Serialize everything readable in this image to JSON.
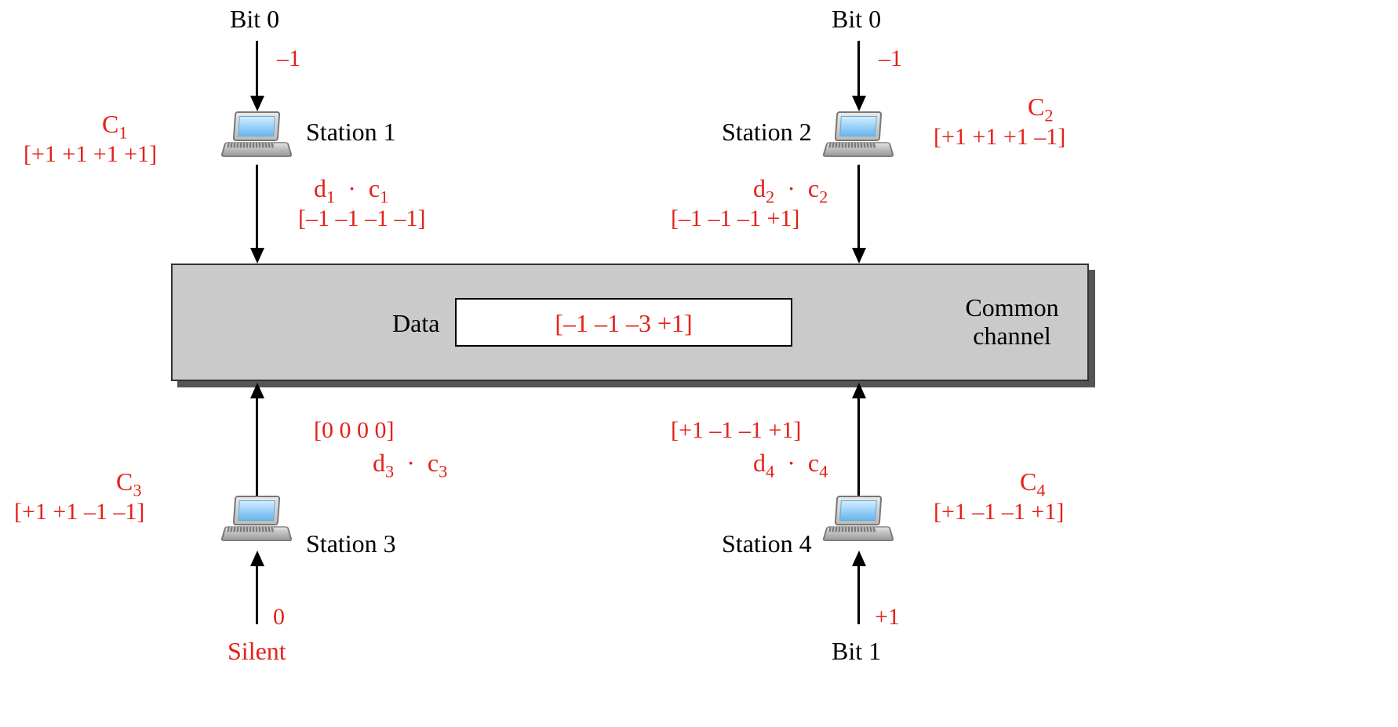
{
  "station1": {
    "bit_label": "Bit 0",
    "bit_value": "–1",
    "name": "Station 1",
    "code_label": "C",
    "code_sub": "1",
    "code_vec": "[+1  +1   +1  +1]",
    "prod_label_d": "d",
    "prod_sub_d": "1",
    "prod_label_c": "c",
    "prod_sub_c": "1",
    "prod_vec": "[–1  –1   –1  –1]"
  },
  "station2": {
    "bit_label": "Bit 0",
    "bit_value": "–1",
    "name": "Station 2",
    "code_label": "C",
    "code_sub": "2",
    "code_vec": "[+1  +1   +1  –1]",
    "prod_label_d": "d",
    "prod_sub_d": "2",
    "prod_label_c": "c",
    "prod_sub_c": "2",
    "prod_vec": "[–1  –1   –1  +1]"
  },
  "station3": {
    "bit_label": "Silent",
    "bit_value": "0",
    "name": "Station 3",
    "code_label": "C",
    "code_sub": "3",
    "code_vec": "[+1  +1   –1  –1]",
    "prod_label_d": "d",
    "prod_sub_d": "3",
    "prod_label_c": "c",
    "prod_sub_c": "3",
    "prod_vec": "[0     0     0      0]"
  },
  "station4": {
    "bit_label": "Bit 1",
    "bit_value": "+1",
    "name": "Station 4",
    "code_label": "C",
    "code_sub": "4",
    "code_vec": "[+1  –1  –1  +1]",
    "prod_label_d": "d",
    "prod_sub_d": "4",
    "prod_label_c": "c",
    "prod_sub_c": "4",
    "prod_vec": "[+1  –1   –1  +1]"
  },
  "channel": {
    "data_label": "Data",
    "data_vec": "[–1 –1   –3  +1]",
    "name_l1": "Common",
    "name_l2": "channel"
  },
  "chart_data": {
    "type": "table",
    "title": "CDMA chip sequence multiplexing on a common channel",
    "stations": [
      {
        "name": "Station 1",
        "input_bit": 0,
        "data_value": -1,
        "code": [
          1,
          1,
          1,
          1
        ],
        "d_times_c": [
          -1,
          -1,
          -1,
          -1
        ]
      },
      {
        "name": "Station 2",
        "input_bit": 0,
        "data_value": -1,
        "code": [
          1,
          1,
          1,
          -1
        ],
        "d_times_c": [
          -1,
          -1,
          -1,
          1
        ]
      },
      {
        "name": "Station 3",
        "input_bit": "Silent",
        "data_value": 0,
        "code": [
          1,
          1,
          -1,
          -1
        ],
        "d_times_c": [
          0,
          0,
          0,
          0
        ]
      },
      {
        "name": "Station 4",
        "input_bit": 1,
        "data_value": 1,
        "code": [
          1,
          -1,
          -1,
          1
        ],
        "d_times_c": [
          1,
          -1,
          -1,
          1
        ]
      }
    ],
    "channel_sum": [
      -1,
      -1,
      -3,
      1
    ]
  }
}
